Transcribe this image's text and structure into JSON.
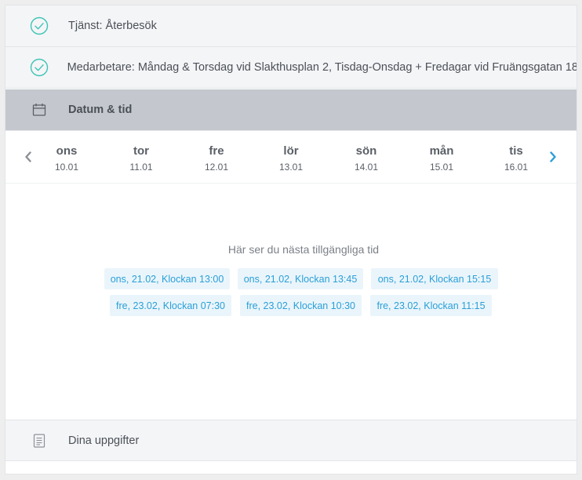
{
  "steps": [
    {
      "label": "Tjänst: Återbesök",
      "icon": "check-circle-icon"
    },
    {
      "label": "Medarbetare: Måndag & Torsdag vid Slakthusplan 2, Tisdag-Onsdag + Fredagar vid Fruängsgatan 18",
      "icon": "check-circle-icon"
    },
    {
      "label": "Datum & tid",
      "icon": "calendar-icon"
    },
    {
      "label": "Dina uppgifter",
      "icon": "document-icon"
    }
  ],
  "days": [
    {
      "name": "ons",
      "date": "10.01"
    },
    {
      "name": "tor",
      "date": "11.01"
    },
    {
      "name": "fre",
      "date": "12.01"
    },
    {
      "name": "lör",
      "date": "13.01"
    },
    {
      "name": "sön",
      "date": "14.01"
    },
    {
      "name": "mån",
      "date": "15.01"
    },
    {
      "name": "tis",
      "date": "16.01"
    }
  ],
  "next_available": {
    "title": "Här ser du nästa tillgängliga tid",
    "slots": [
      "ons, 21.02, Klockan 13:00",
      "ons, 21.02, Klockan 13:45",
      "ons, 21.02, Klockan 15:15",
      "fre, 23.02, Klockan 07:30",
      "fre, 23.02, Klockan 10:30",
      "fre, 23.02, Klockan 11:15"
    ]
  },
  "colors": {
    "accent": "#2a9fd8",
    "check": "#3cc3b4",
    "active_step_bg": "#c4c8ce"
  }
}
